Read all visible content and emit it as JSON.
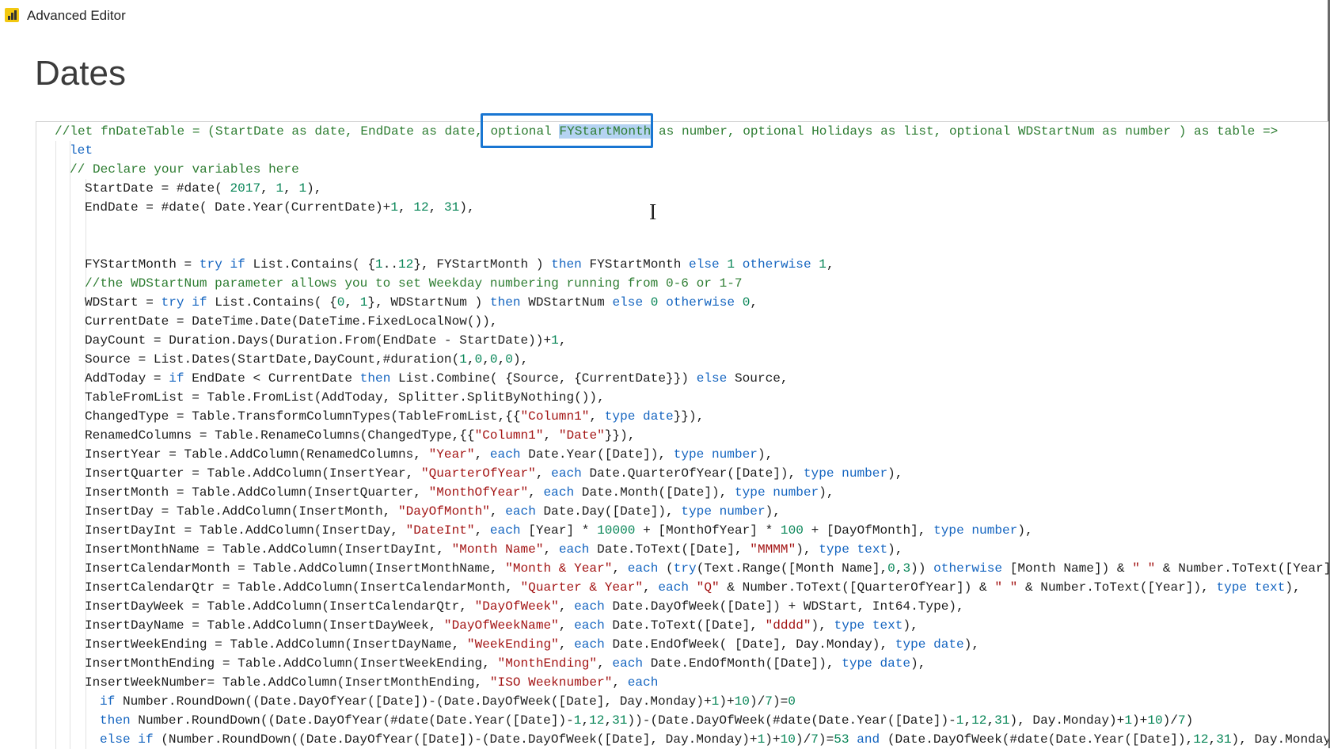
{
  "window": {
    "title": "Advanced Editor",
    "app_icon": "power-bi-icon"
  },
  "query_name": "Dates",
  "editor": {
    "colors": {
      "keyword": "#1565c0",
      "number": "#098658",
      "string": "#a31515",
      "comment": "#2e7d32",
      "selection": "#b5d3f2",
      "focus_box": "#1976d2"
    },
    "cursor_icon": "text-cursor-icon",
    "lines": [
      {
        "indent": 1,
        "tokens": [
          [
            "c",
            "//let fnDateTable = (StartDate as date, EndDate as date, "
          ],
          [
            "c",
            "optional "
          ],
          [
            "c",
            "FYStartMonth",
            "hl"
          ],
          [
            "c",
            " as number, optional Holidays as list, optional WDStartNum as number ) as table =>"
          ]
        ]
      },
      {
        "indent": 2,
        "tokens": [
          [
            "k",
            "let"
          ]
        ]
      },
      {
        "indent": 2,
        "tokens": [
          [
            "c",
            "// Declare your variables here"
          ]
        ]
      },
      {
        "indent": 3,
        "tokens": [
          [
            "t",
            "StartDate = #date( "
          ],
          [
            "n",
            "2017"
          ],
          [
            "t",
            ", "
          ],
          [
            "n",
            "1"
          ],
          [
            "t",
            ", "
          ],
          [
            "n",
            "1"
          ],
          [
            "t",
            "),"
          ]
        ]
      },
      {
        "indent": 3,
        "tokens": [
          [
            "t",
            "EndDate = #date( Date.Year(CurrentDate)+"
          ],
          [
            "n",
            "1"
          ],
          [
            "t",
            ", "
          ],
          [
            "n",
            "12"
          ],
          [
            "t",
            ", "
          ],
          [
            "n",
            "31"
          ],
          [
            "t",
            "),"
          ]
        ]
      },
      {
        "indent": 3,
        "tokens": []
      },
      {
        "indent": 3,
        "tokens": []
      },
      {
        "indent": 3,
        "tokens": [
          [
            "t",
            "FYStartMonth = "
          ],
          [
            "k",
            "try if"
          ],
          [
            "t",
            " List.Contains( {"
          ],
          [
            "n",
            "1"
          ],
          [
            "t",
            ".."
          ],
          [
            "n",
            "12"
          ],
          [
            "t",
            "}, FYStartMonth ) "
          ],
          [
            "k",
            "then"
          ],
          [
            "t",
            " FYStartMonth "
          ],
          [
            "k",
            "else"
          ],
          [
            "t",
            " "
          ],
          [
            "n",
            "1"
          ],
          [
            "t",
            " "
          ],
          [
            "k",
            "otherwise"
          ],
          [
            "t",
            " "
          ],
          [
            "n",
            "1"
          ],
          [
            "t",
            ","
          ]
        ]
      },
      {
        "indent": 3,
        "tokens": [
          [
            "c",
            "//the WDStartNum parameter allows you to set Weekday numbering running from 0-6 or 1-7"
          ]
        ]
      },
      {
        "indent": 3,
        "tokens": [
          [
            "t",
            "WDStart = "
          ],
          [
            "k",
            "try if"
          ],
          [
            "t",
            " List.Contains( {"
          ],
          [
            "n",
            "0"
          ],
          [
            "t",
            ", "
          ],
          [
            "n",
            "1"
          ],
          [
            "t",
            "}, WDStartNum ) "
          ],
          [
            "k",
            "then"
          ],
          [
            "t",
            " WDStartNum "
          ],
          [
            "k",
            "else"
          ],
          [
            "t",
            " "
          ],
          [
            "n",
            "0"
          ],
          [
            "t",
            " "
          ],
          [
            "k",
            "otherwise"
          ],
          [
            "t",
            " "
          ],
          [
            "n",
            "0"
          ],
          [
            "t",
            ","
          ]
        ]
      },
      {
        "indent": 3,
        "tokens": [
          [
            "t",
            "CurrentDate = DateTime.Date(DateTime.FixedLocalNow()),"
          ]
        ]
      },
      {
        "indent": 3,
        "tokens": [
          [
            "t",
            "DayCount = Duration.Days(Duration.From(EndDate - StartDate))+"
          ],
          [
            "n",
            "1"
          ],
          [
            "t",
            ","
          ]
        ]
      },
      {
        "indent": 3,
        "tokens": [
          [
            "t",
            "Source = List.Dates(StartDate,DayCount,#duration("
          ],
          [
            "n",
            "1"
          ],
          [
            "t",
            ","
          ],
          [
            "n",
            "0"
          ],
          [
            "t",
            ","
          ],
          [
            "n",
            "0"
          ],
          [
            "t",
            ","
          ],
          [
            "n",
            "0"
          ],
          [
            "t",
            "),"
          ]
        ]
      },
      {
        "indent": 3,
        "tokens": [
          [
            "t",
            "AddToday = "
          ],
          [
            "k",
            "if"
          ],
          [
            "t",
            " EndDate < CurrentDate "
          ],
          [
            "k",
            "then"
          ],
          [
            "t",
            " List.Combine( {Source, {CurrentDate}}) "
          ],
          [
            "k",
            "else"
          ],
          [
            "t",
            " Source,"
          ]
        ]
      },
      {
        "indent": 3,
        "tokens": [
          [
            "t",
            "TableFromList = Table.FromList(AddToday, Splitter.SplitByNothing()),"
          ]
        ]
      },
      {
        "indent": 3,
        "tokens": [
          [
            "t",
            "ChangedType = Table.TransformColumnTypes(TableFromList,{{"
          ],
          [
            "s",
            "\"Column1\""
          ],
          [
            "t",
            ", "
          ],
          [
            "k",
            "type date"
          ],
          [
            "t",
            "}}),"
          ]
        ]
      },
      {
        "indent": 3,
        "tokens": [
          [
            "t",
            "RenamedColumns = Table.RenameColumns(ChangedType,{{"
          ],
          [
            "s",
            "\"Column1\""
          ],
          [
            "t",
            ", "
          ],
          [
            "s",
            "\"Date\""
          ],
          [
            "t",
            "}}),"
          ]
        ]
      },
      {
        "indent": 3,
        "tokens": [
          [
            "t",
            "InsertYear = Table.AddColumn(RenamedColumns, "
          ],
          [
            "s",
            "\"Year\""
          ],
          [
            "t",
            ", "
          ],
          [
            "k",
            "each"
          ],
          [
            "t",
            " Date.Year([Date]), "
          ],
          [
            "k",
            "type number"
          ],
          [
            "t",
            "),"
          ]
        ]
      },
      {
        "indent": 3,
        "tokens": [
          [
            "t",
            "InsertQuarter = Table.AddColumn(InsertYear, "
          ],
          [
            "s",
            "\"QuarterOfYear\""
          ],
          [
            "t",
            ", "
          ],
          [
            "k",
            "each"
          ],
          [
            "t",
            " Date.QuarterOfYear([Date]), "
          ],
          [
            "k",
            "type number"
          ],
          [
            "t",
            "),"
          ]
        ]
      },
      {
        "indent": 3,
        "tokens": [
          [
            "t",
            "InsertMonth = Table.AddColumn(InsertQuarter, "
          ],
          [
            "s",
            "\"MonthOfYear\""
          ],
          [
            "t",
            ", "
          ],
          [
            "k",
            "each"
          ],
          [
            "t",
            " Date.Month([Date]), "
          ],
          [
            "k",
            "type number"
          ],
          [
            "t",
            "),"
          ]
        ]
      },
      {
        "indent": 3,
        "tokens": [
          [
            "t",
            "InsertDay = Table.AddColumn(InsertMonth, "
          ],
          [
            "s",
            "\"DayOfMonth\""
          ],
          [
            "t",
            ", "
          ],
          [
            "k",
            "each"
          ],
          [
            "t",
            " Date.Day([Date]), "
          ],
          [
            "k",
            "type number"
          ],
          [
            "t",
            "),"
          ]
        ]
      },
      {
        "indent": 3,
        "tokens": [
          [
            "t",
            "InsertDayInt = Table.AddColumn(InsertDay, "
          ],
          [
            "s",
            "\"DateInt\""
          ],
          [
            "t",
            ", "
          ],
          [
            "k",
            "each"
          ],
          [
            "t",
            " [Year] * "
          ],
          [
            "n",
            "10000"
          ],
          [
            "t",
            " + [MonthOfYear] * "
          ],
          [
            "n",
            "100"
          ],
          [
            "t",
            " + [DayOfMonth], "
          ],
          [
            "k",
            "type number"
          ],
          [
            "t",
            "),"
          ]
        ]
      },
      {
        "indent": 3,
        "tokens": [
          [
            "t",
            "InsertMonthName = Table.AddColumn(InsertDayInt, "
          ],
          [
            "s",
            "\"Month Name\""
          ],
          [
            "t",
            ", "
          ],
          [
            "k",
            "each"
          ],
          [
            "t",
            " Date.ToText([Date], "
          ],
          [
            "s",
            "\"MMMM\""
          ],
          [
            "t",
            "), "
          ],
          [
            "k",
            "type text"
          ],
          [
            "t",
            "),"
          ]
        ]
      },
      {
        "indent": 3,
        "tokens": [
          [
            "t",
            "InsertCalendarMonth = Table.AddColumn(InsertMonthName, "
          ],
          [
            "s",
            "\"Month & Year\""
          ],
          [
            "t",
            ", "
          ],
          [
            "k",
            "each"
          ],
          [
            "t",
            " ("
          ],
          [
            "k",
            "try"
          ],
          [
            "t",
            "(Text.Range([Month Name],"
          ],
          [
            "n",
            "0"
          ],
          [
            "t",
            ","
          ],
          [
            "n",
            "3"
          ],
          [
            "t",
            ")) "
          ],
          [
            "k",
            "otherwise"
          ],
          [
            "t",
            " [Month Name]) & "
          ],
          [
            "s",
            "\" \""
          ],
          [
            "t",
            " & Number.ToText([Year])"
          ]
        ]
      },
      {
        "indent": 3,
        "tokens": [
          [
            "t",
            "InsertCalendarQtr = Table.AddColumn(InsertCalendarMonth, "
          ],
          [
            "s",
            "\"Quarter & Year\""
          ],
          [
            "t",
            ", "
          ],
          [
            "k",
            "each"
          ],
          [
            "t",
            " "
          ],
          [
            "s",
            "\"Q\""
          ],
          [
            "t",
            " & Number.ToText([QuarterOfYear]) & "
          ],
          [
            "s",
            "\" \""
          ],
          [
            "t",
            " & Number.ToText([Year]), "
          ],
          [
            "k",
            "type text"
          ],
          [
            "t",
            "),"
          ]
        ]
      },
      {
        "indent": 3,
        "tokens": [
          [
            "t",
            "InsertDayWeek = Table.AddColumn(InsertCalendarQtr, "
          ],
          [
            "s",
            "\"DayOfWeek\""
          ],
          [
            "t",
            ", "
          ],
          [
            "k",
            "each"
          ],
          [
            "t",
            " Date.DayOfWeek([Date]) + WDStart, Int64.Type),"
          ]
        ]
      },
      {
        "indent": 3,
        "tokens": [
          [
            "t",
            "InsertDayName = Table.AddColumn(InsertDayWeek, "
          ],
          [
            "s",
            "\"DayOfWeekName\""
          ],
          [
            "t",
            ", "
          ],
          [
            "k",
            "each"
          ],
          [
            "t",
            " Date.ToText([Date], "
          ],
          [
            "s",
            "\"dddd\""
          ],
          [
            "t",
            "), "
          ],
          [
            "k",
            "type text"
          ],
          [
            "t",
            "),"
          ]
        ]
      },
      {
        "indent": 3,
        "tokens": [
          [
            "t",
            "InsertWeekEnding = Table.AddColumn(InsertDayName, "
          ],
          [
            "s",
            "\"WeekEnding\""
          ],
          [
            "t",
            ", "
          ],
          [
            "k",
            "each"
          ],
          [
            "t",
            " Date.EndOfWeek( [Date], Day.Monday), "
          ],
          [
            "k",
            "type date"
          ],
          [
            "t",
            "),"
          ]
        ]
      },
      {
        "indent": 3,
        "tokens": [
          [
            "t",
            "InsertMonthEnding = Table.AddColumn(InsertWeekEnding, "
          ],
          [
            "s",
            "\"MonthEnding\""
          ],
          [
            "t",
            ", "
          ],
          [
            "k",
            "each"
          ],
          [
            "t",
            " Date.EndOfMonth([Date]), "
          ],
          [
            "k",
            "type date"
          ],
          [
            "t",
            "),"
          ]
        ]
      },
      {
        "indent": 3,
        "tokens": [
          [
            "t",
            "InsertWeekNumber= Table.AddColumn(InsertMonthEnding, "
          ],
          [
            "s",
            "\"ISO Weeknumber\""
          ],
          [
            "t",
            ", "
          ],
          [
            "k",
            "each"
          ]
        ]
      },
      {
        "indent": 4,
        "tokens": [
          [
            "k",
            "if"
          ],
          [
            "t",
            " Number.RoundDown((Date.DayOfYear([Date])-(Date.DayOfWeek([Date], Day.Monday)+"
          ],
          [
            "n",
            "1"
          ],
          [
            "t",
            ")+"
          ],
          [
            "n",
            "10"
          ],
          [
            "t",
            ")/"
          ],
          [
            "n",
            "7"
          ],
          [
            "t",
            ")="
          ],
          [
            "n",
            "0"
          ]
        ]
      },
      {
        "indent": 4,
        "tokens": [
          [
            "k",
            "then"
          ],
          [
            "t",
            " Number.RoundDown((Date.DayOfYear(#date(Date.Year([Date])-"
          ],
          [
            "n",
            "1"
          ],
          [
            "t",
            ","
          ],
          [
            "n",
            "12"
          ],
          [
            "t",
            ","
          ],
          [
            "n",
            "31"
          ],
          [
            "t",
            "))-(Date.DayOfWeek(#date(Date.Year([Date])-"
          ],
          [
            "n",
            "1"
          ],
          [
            "t",
            ","
          ],
          [
            "n",
            "12"
          ],
          [
            "t",
            ","
          ],
          [
            "n",
            "31"
          ],
          [
            "t",
            "), Day.Monday)+"
          ],
          [
            "n",
            "1"
          ],
          [
            "t",
            ")+"
          ],
          [
            "n",
            "10"
          ],
          [
            "t",
            ")/"
          ],
          [
            "n",
            "7"
          ],
          [
            "t",
            ")"
          ]
        ]
      },
      {
        "indent": 4,
        "tokens": [
          [
            "k",
            "else if"
          ],
          [
            "t",
            " (Number.RoundDown((Date.DayOfYear([Date])-(Date.DayOfWeek([Date], Day.Monday)+"
          ],
          [
            "n",
            "1"
          ],
          [
            "t",
            ")+"
          ],
          [
            "n",
            "10"
          ],
          [
            "t",
            ")/"
          ],
          [
            "n",
            "7"
          ],
          [
            "t",
            ")="
          ],
          [
            "n",
            "53"
          ],
          [
            "t",
            " "
          ],
          [
            "k",
            "and"
          ],
          [
            "t",
            " (Date.DayOfWeek(#date(Date.Year([Date]),"
          ],
          [
            "n",
            "12"
          ],
          [
            "t",
            ","
          ],
          [
            "n",
            "31"
          ],
          [
            "t",
            "), Day.Monday"
          ]
        ]
      }
    ]
  }
}
